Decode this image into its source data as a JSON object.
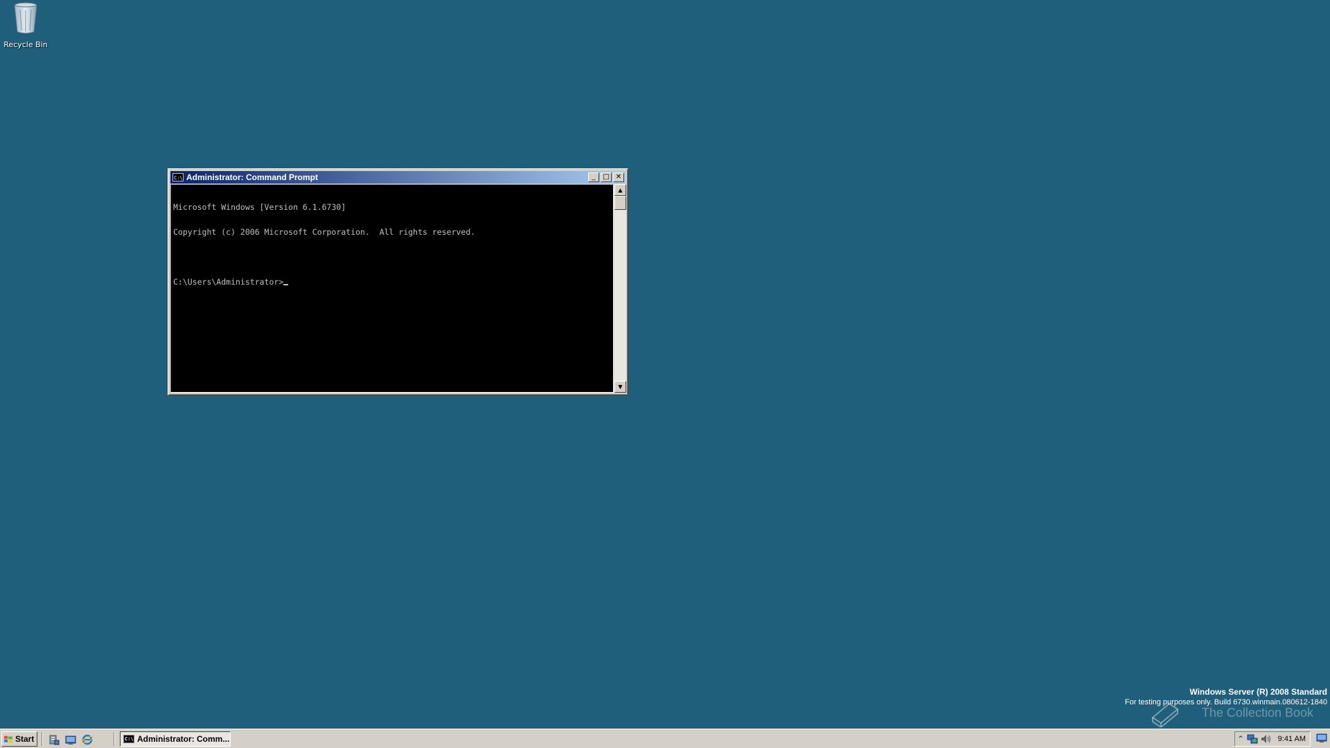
{
  "desktop": {
    "background_color": "#1f5f7b",
    "icons": [
      {
        "label": "Recycle Bin",
        "icon": "recycle-bin-icon"
      }
    ]
  },
  "cmd_window": {
    "title": "Administrator: Command Prompt",
    "title_icon_text": "C:\\",
    "buttons": {
      "minimize": "_",
      "maximize": "□",
      "close": "✕"
    },
    "console_lines": [
      "Microsoft Windows [Version 6.1.6730]",
      "Copyright (c) 2006 Microsoft Corporation.  All rights reserved.",
      "",
      "C:\\Users\\Administrator>"
    ],
    "scroll_up": "▲",
    "scroll_down": "▼"
  },
  "watermark": {
    "title": "Windows Server (R) 2008 Standard",
    "build": "For testing purposes only. Build 6730.winmain.080612-1840",
    "collection_text": "The Collection Book"
  },
  "taskbar": {
    "start_label": "Start",
    "quick_launch": [
      "server-manager-icon",
      "show-desktop-icon",
      "internet-explorer-icon"
    ],
    "task_button_label": "Administrator: Comm...",
    "tray_chevron": "^",
    "clock": "9:41 AM"
  },
  "colors": {
    "titlebar_start": "#0a246a",
    "titlebar_end": "#a6caf0",
    "chrome": "#d4d0c8"
  }
}
